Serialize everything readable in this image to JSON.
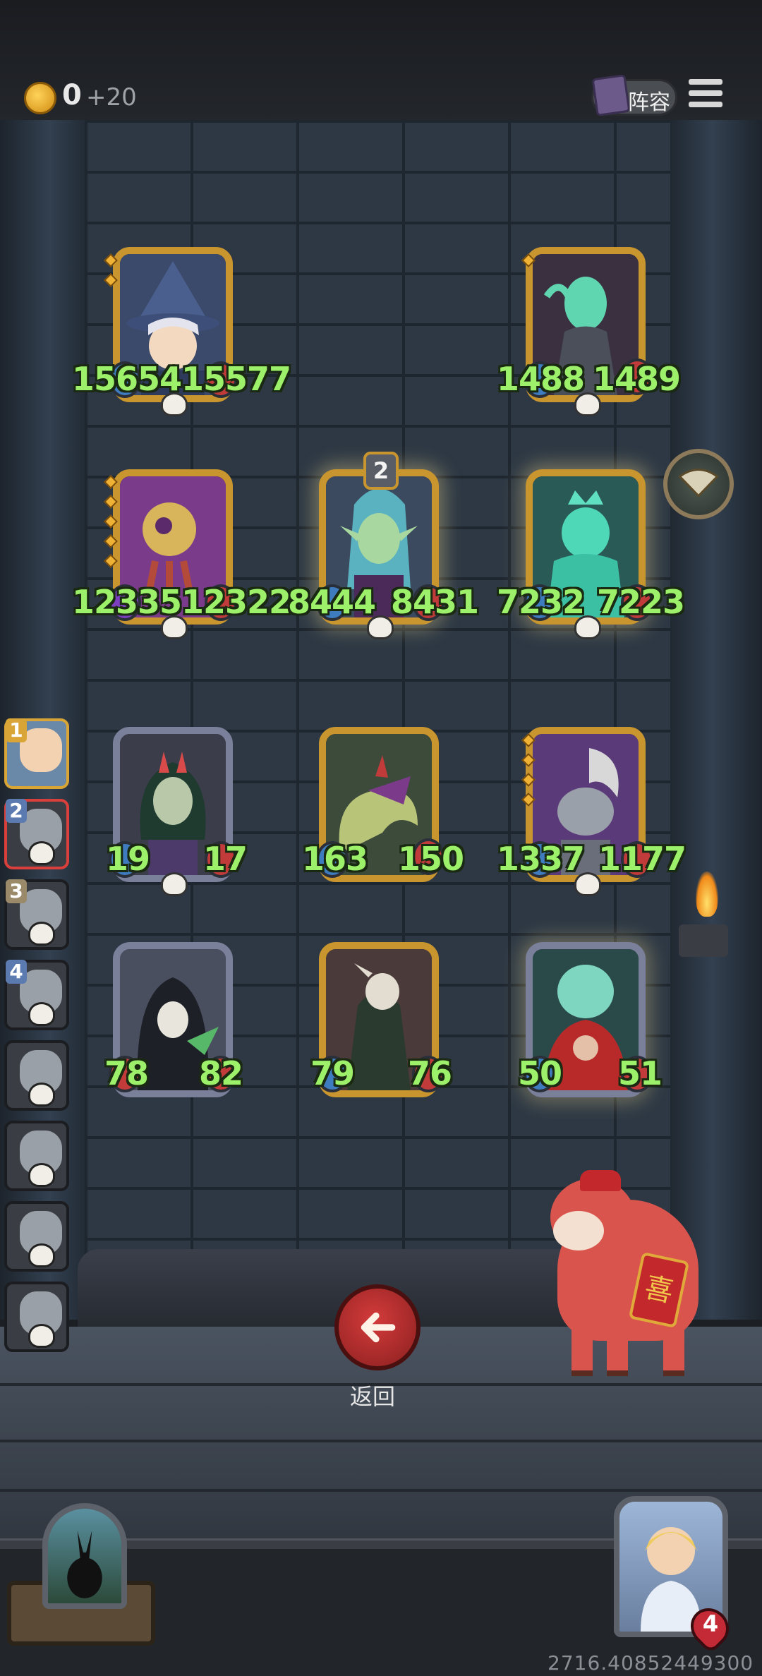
{
  "topbar": {
    "gold_count": "0",
    "gold_gain": "+20",
    "lineup_label": "阵容"
  },
  "board": {
    "cards": [
      {
        "id": "wizard",
        "attack": "1565415577",
        "frame": "gold"
      },
      {
        "id": "spectre",
        "attack": "1488",
        "health": "1489",
        "frame": "gold"
      },
      {
        "id": "puppet",
        "attack": "1233512322",
        "frame": "gold"
      },
      {
        "id": "elf-queen",
        "attack": "8444",
        "health": "8431",
        "frame": "gold",
        "level": "2"
      },
      {
        "id": "ghost-king",
        "attack": "7232",
        "health": "7223",
        "frame": "gold"
      },
      {
        "id": "horned-witch",
        "attack": "19",
        "health": "17",
        "frame": "silver"
      },
      {
        "id": "serpent",
        "attack": "163",
        "health": "150",
        "frame": "gold"
      },
      {
        "id": "skull-beast",
        "attack": "1337",
        "health": "1177",
        "frame": "gold"
      },
      {
        "id": "reaper",
        "attack": "78",
        "health": "82",
        "frame": "silver"
      },
      {
        "id": "shaman",
        "attack": "79",
        "health": "76",
        "frame": "gold"
      },
      {
        "id": "phantom",
        "attack": "50",
        "health": "51",
        "frame": "silver"
      }
    ]
  },
  "team": {
    "slots": [
      {
        "number": "1",
        "state": "selected"
      },
      {
        "number": "2",
        "state": "active"
      },
      {
        "number": "3",
        "state": "defeated"
      },
      {
        "number": "4",
        "state": "defeated"
      },
      {
        "number": "",
        "state": "defeated"
      },
      {
        "number": "",
        "state": "defeated"
      },
      {
        "number": "",
        "state": "defeated"
      },
      {
        "number": "",
        "state": "defeated"
      }
    ]
  },
  "back_button": {
    "label": "返回"
  },
  "mascot": {
    "sign": "喜"
  },
  "player": {
    "lives": "4"
  },
  "footer": {
    "coordinates": "2716.40852449300"
  },
  "colors": {
    "stat_green": "#9df06a",
    "gold_frame": "#c9952e",
    "back_red": "#c23b3b"
  }
}
